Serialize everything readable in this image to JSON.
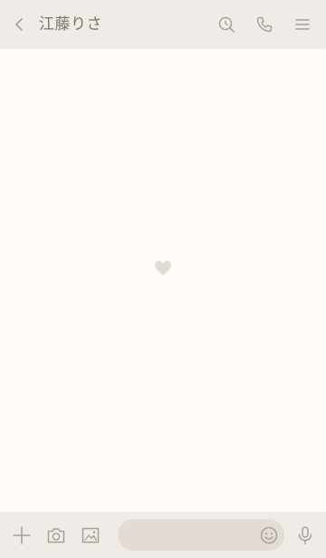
{
  "header": {
    "title": "江藤りさ",
    "icons": [
      "chevron-left-icon",
      "search-icon",
      "phone-icon",
      "menu-icon"
    ]
  },
  "footer": {
    "icons": [
      "plus-icon",
      "camera-icon",
      "image-icon",
      "emoji-icon",
      "microphone-icon"
    ],
    "message_value": "",
    "message_placeholder": ""
  },
  "colors": {
    "bar_background": "#efebe6",
    "chat_background": "#fffcf8",
    "icon": "#a9a095",
    "title_text": "#7d7468",
    "input_background": "#e4dcd4",
    "heart": "#e2dcd6"
  }
}
